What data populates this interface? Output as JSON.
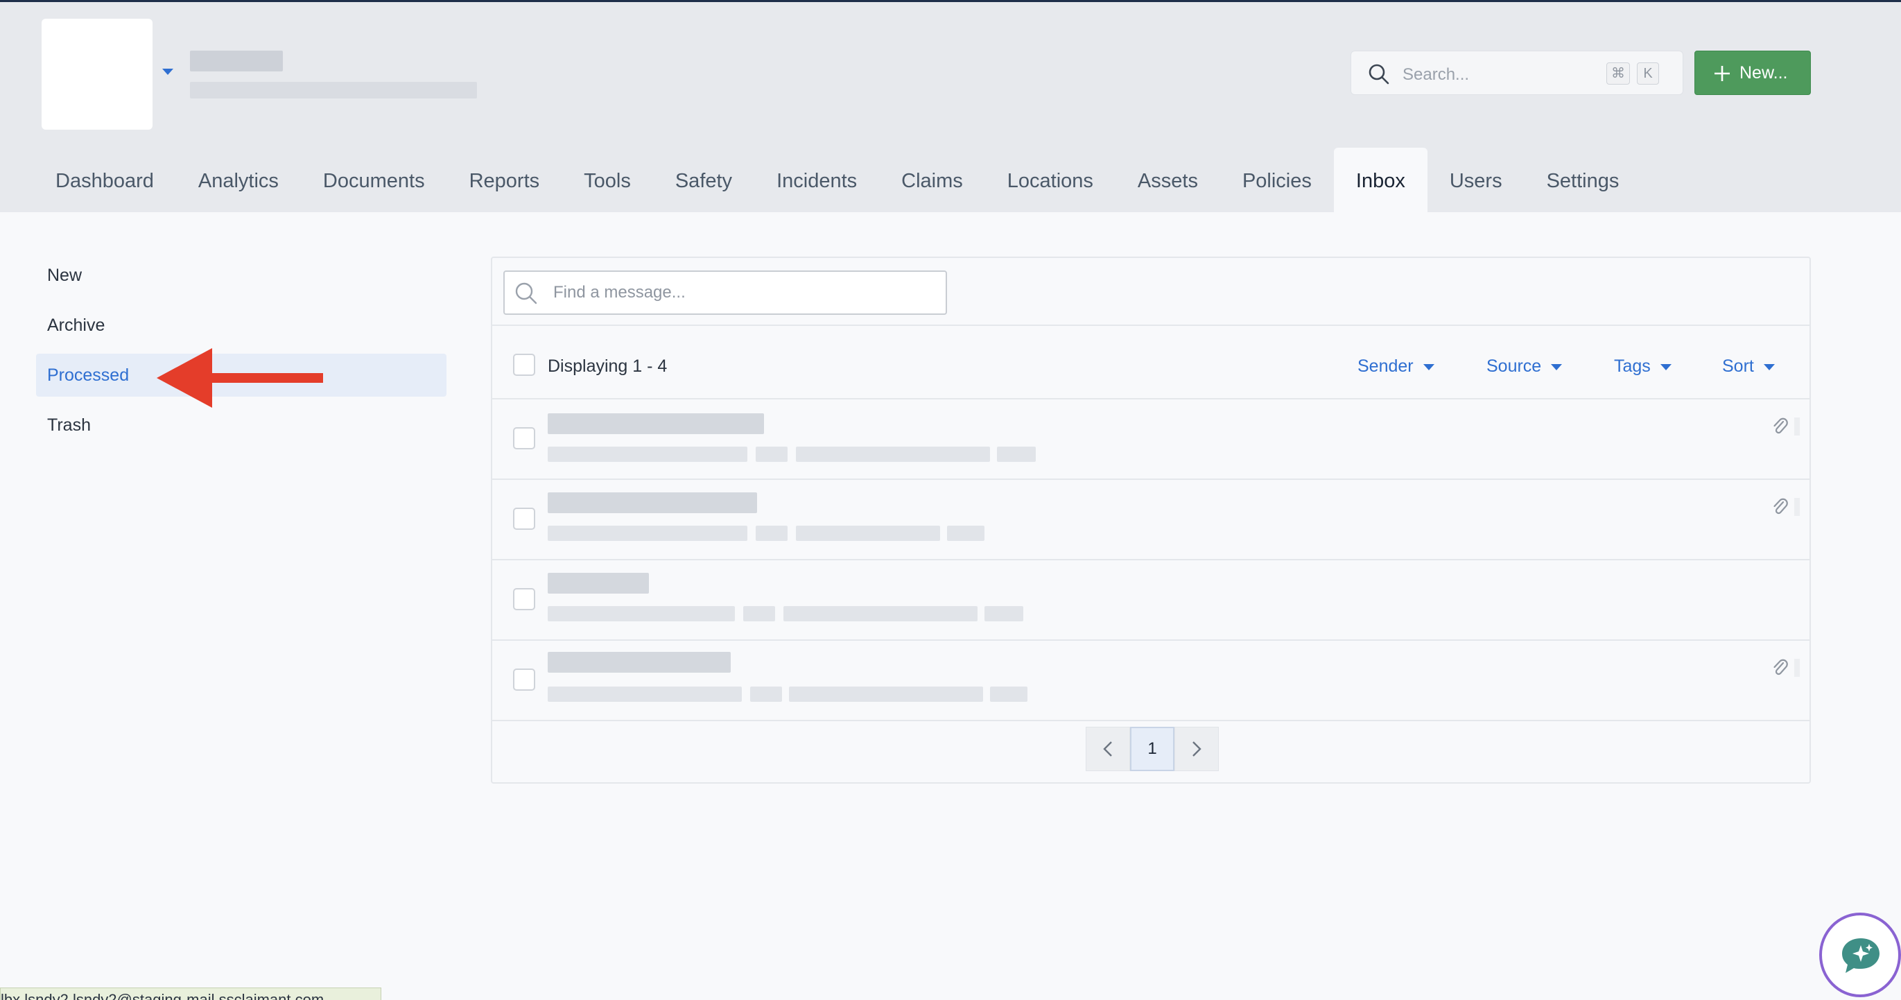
{
  "header": {
    "search": {
      "placeholder": "Search...",
      "shortcut": [
        "⌘",
        "K"
      ]
    },
    "new_button": "New..."
  },
  "tabs": [
    {
      "label": "Dashboard"
    },
    {
      "label": "Analytics"
    },
    {
      "label": "Documents"
    },
    {
      "label": "Reports"
    },
    {
      "label": "Tools"
    },
    {
      "label": "Safety"
    },
    {
      "label": "Incidents"
    },
    {
      "label": "Claims"
    },
    {
      "label": "Locations"
    },
    {
      "label": "Assets"
    },
    {
      "label": "Policies"
    },
    {
      "label": "Inbox",
      "active": true
    },
    {
      "label": "Users"
    },
    {
      "label": "Settings"
    }
  ],
  "sidebar": {
    "items": [
      {
        "label": "New"
      },
      {
        "label": "Archive"
      },
      {
        "label": "Processed",
        "active": true
      },
      {
        "label": "Trash"
      }
    ]
  },
  "inbox": {
    "find_placeholder": "Find a message...",
    "displaying": "Displaying 1 - 4",
    "filters": {
      "sender": "Sender",
      "source": "Source",
      "tags": "Tags",
      "sort": "Sort"
    },
    "messages": [
      {
        "has_attachment": true
      },
      {
        "has_attachment": true
      },
      {
        "has_attachment": false
      },
      {
        "has_attachment": true
      }
    ],
    "pagination": {
      "current_page": "1"
    }
  },
  "status_bar": {
    "url": "lbx.lsndy2.lsndy2@staging-mail.ssclaimant.com"
  },
  "colors": {
    "accent": "#2f6fd1",
    "new_button": "#4e9a5c",
    "annotation_arrow": "#e43d2a",
    "fab_ring": "#8a63d2"
  }
}
